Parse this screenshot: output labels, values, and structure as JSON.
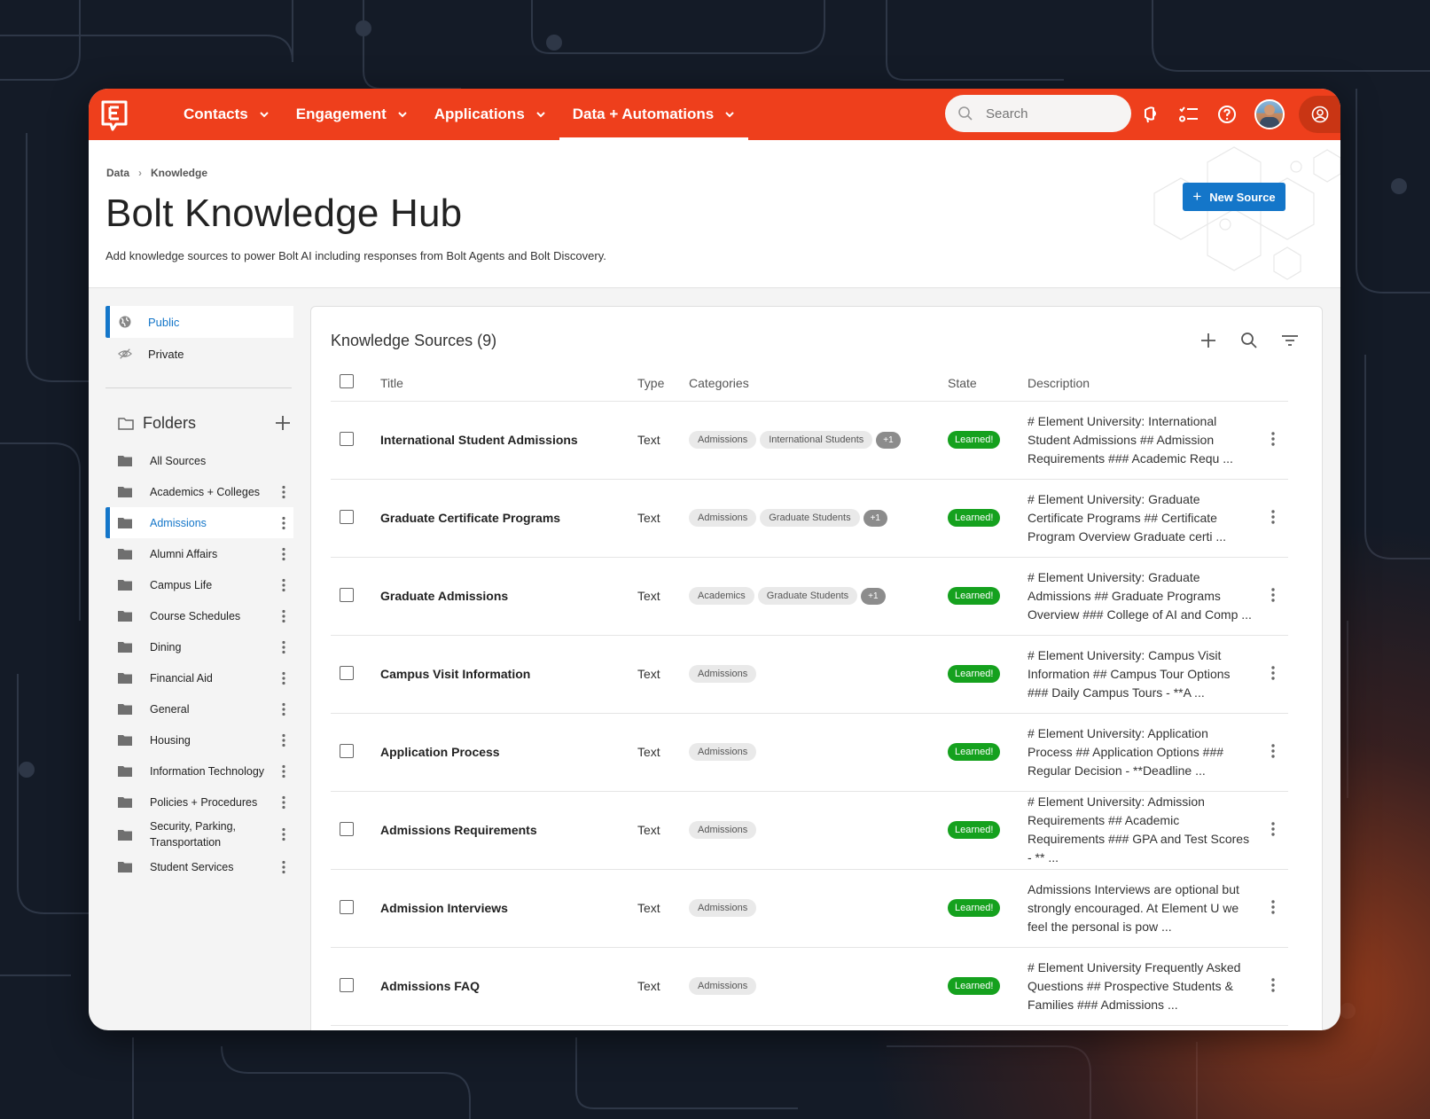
{
  "nav": {
    "items": [
      {
        "label": "Contacts"
      },
      {
        "label": "Engagement"
      },
      {
        "label": "Applications"
      },
      {
        "label": "Data + Automations"
      }
    ],
    "search_placeholder": "Search"
  },
  "breadcrumb": {
    "root": "Data",
    "current": "Knowledge"
  },
  "page": {
    "title": "Bolt Knowledge Hub",
    "subtitle": "Add knowledge sources to power Bolt AI including responses from Bolt Agents and Bolt Discovery.",
    "new_source_label": "New Source"
  },
  "visibility": [
    {
      "label": "Public",
      "icon": "globe-icon"
    },
    {
      "label": "Private",
      "icon": "eye-off-icon"
    }
  ],
  "folders": {
    "title": "Folders",
    "items": [
      {
        "label": "All Sources"
      },
      {
        "label": "Academics + Colleges"
      },
      {
        "label": "Admissions"
      },
      {
        "label": "Alumni Affairs"
      },
      {
        "label": "Campus Life"
      },
      {
        "label": "Course Schedules"
      },
      {
        "label": "Dining"
      },
      {
        "label": "Financial Aid"
      },
      {
        "label": "General"
      },
      {
        "label": "Housing"
      },
      {
        "label": "Information Technology"
      },
      {
        "label": "Policies + Procedures"
      },
      {
        "label": "Security, Parking, Transportation"
      },
      {
        "label": "Student Services"
      }
    ]
  },
  "sources": {
    "title": "Knowledge Sources (9)",
    "columns": {
      "title": "Title",
      "type": "Type",
      "categories": "Categories",
      "state": "State",
      "description": "Description"
    },
    "rows": [
      {
        "title": "International Student Admissions",
        "type": "Text",
        "chips": [
          "Admissions",
          "International Students",
          "+1"
        ],
        "state": "Learned!",
        "description": "# Element University: International Student Admissions ## Admission Requirements ### Academic Requ ..."
      },
      {
        "title": "Graduate Certificate Programs",
        "type": "Text",
        "chips": [
          "Admissions",
          "Graduate Students",
          "+1"
        ],
        "state": "Learned!",
        "description": "# Element University: Graduate Certificate Programs ## Certificate Program Overview Graduate certi ..."
      },
      {
        "title": "Graduate Admissions",
        "type": "Text",
        "chips": [
          "Academics",
          "Graduate Students",
          "+1"
        ],
        "state": "Learned!",
        "description": "# Element University: Graduate Admissions ## Graduate Programs Overview ### College of AI and Comp ..."
      },
      {
        "title": "Campus Visit Information",
        "type": "Text",
        "chips": [
          "Admissions"
        ],
        "state": "Learned!",
        "description": "# Element University: Campus Visit Information ## Campus Tour Options ### Daily Campus Tours - **A ..."
      },
      {
        "title": "Application Process",
        "type": "Text",
        "chips": [
          "Admissions"
        ],
        "state": "Learned!",
        "description": "# Element University: Application Process ## Application Options ### Regular Decision - **Deadline ..."
      },
      {
        "title": "Admissions Requirements",
        "type": "Text",
        "chips": [
          "Admissions"
        ],
        "state": "Learned!",
        "description": "# Element University: Admission Requirements ## Academic Requirements ### GPA and Test Scores - ** ..."
      },
      {
        "title": "Admission Interviews",
        "type": "Text",
        "chips": [
          "Admissions"
        ],
        "state": "Learned!",
        "description": "Admissions Interviews are optional but strongly encouraged. At Element U we feel the personal is pow ..."
      },
      {
        "title": "Admissions FAQ",
        "type": "Text",
        "chips": [
          "Admissions"
        ],
        "state": "Learned!",
        "description": "# Element University Frequently Asked Questions ## Prospective Students & Families ### Admissions ..."
      }
    ]
  },
  "colors": {
    "brand": "#ee3f1c",
    "accent": "#1476c9",
    "success": "#15a11e"
  }
}
